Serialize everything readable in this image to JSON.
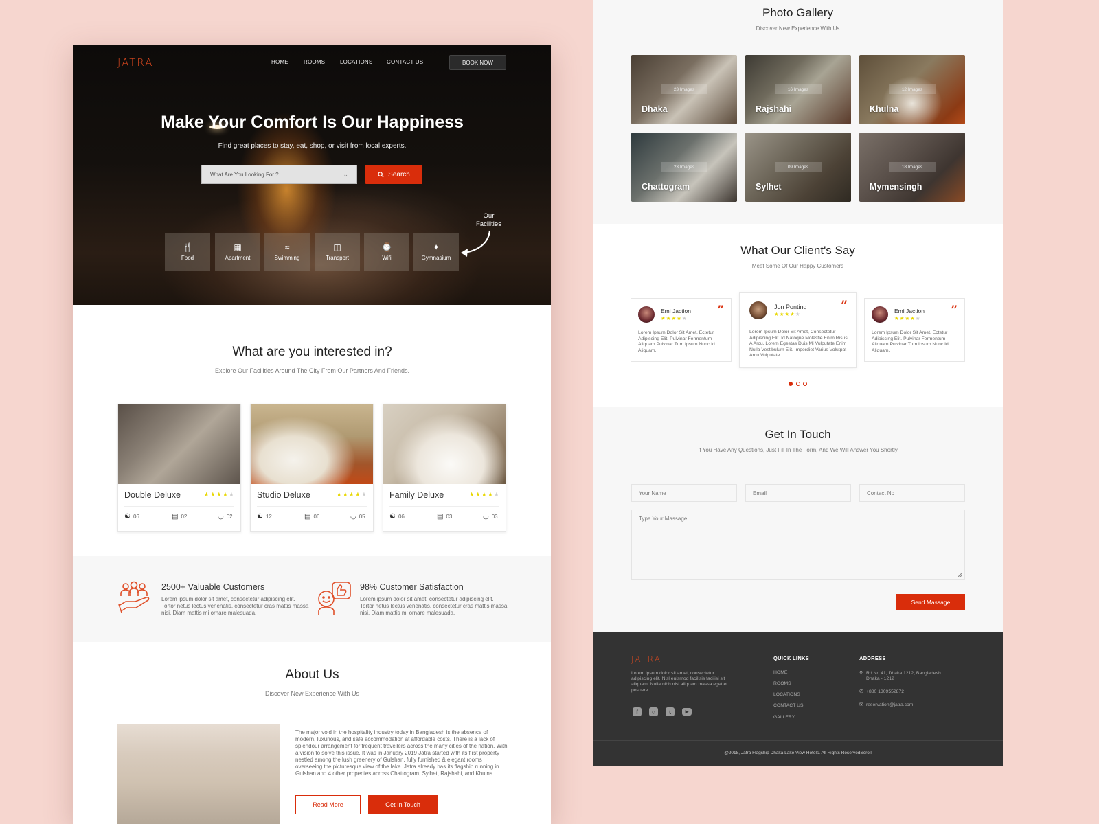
{
  "brand": {
    "logo": "JATRA",
    "accent": "#d92d0b"
  },
  "nav": {
    "links": [
      "HOME",
      "ROOMS",
      "LOCATIONS",
      "CONTACT US"
    ],
    "book_now": "BOOK NOW"
  },
  "hero": {
    "title": "Make Your Comfort Is Our Happiness",
    "subtitle": "Find great places to stay, eat, shop, or visit from local experts.",
    "search_placeholder": "What Are You Looking For ?",
    "search_button": "Search",
    "facilities_label_1": "Our",
    "facilities_label_2": "Facilities",
    "facilities": [
      {
        "label": "Food",
        "icon": "cutlery-icon"
      },
      {
        "label": "Apartment",
        "icon": "building-icon"
      },
      {
        "label": "Swimming",
        "icon": "swimmer-icon"
      },
      {
        "label": "Transport",
        "icon": "van-icon"
      },
      {
        "label": "Wifi",
        "icon": "wifi-icon"
      },
      {
        "label": "Gymnasium",
        "icon": "gymnast-icon"
      }
    ]
  },
  "interested": {
    "title": "What are you interested in?",
    "subtitle": "Explore Our Facilities Around The City From Our Partners And Friends.",
    "rooms": [
      {
        "name": "Double Deluxe",
        "rating": 4,
        "max_rating": 5,
        "guests": "06",
        "beds": "02",
        "baths": "02"
      },
      {
        "name": "Studio Deluxe",
        "rating": 4,
        "max_rating": 5,
        "guests": "12",
        "beds": "06",
        "baths": "05"
      },
      {
        "name": "Family Deluxe",
        "rating": 4,
        "max_rating": 5,
        "guests": "06",
        "beds": "03",
        "baths": "03"
      }
    ]
  },
  "stats": [
    {
      "title": "2500+ Valuable Customers",
      "text": "Lorem ipsum dolor sit amet, consectetur adipiscing elit. Tortor netus lectus venenatis, consectetur cras mattis massa nisi. Diam mattis mi ornare malesuada."
    },
    {
      "title": "98% Customer Satisfaction",
      "text": "Lorem ipsum dolor sit amet, consectetur adipiscing elit. Tortor netus lectus venenatis, consectetur cras mattis massa nisi. Diam mattis mi ornare malesuada."
    }
  ],
  "about": {
    "title": "About Us",
    "subtitle": "Discover New Experience With Us",
    "text": "The major void in the hospitality industry today in Bangladesh is the absence of modern, luxurious, and safe accommodation at affordable costs. There is a lack of splendour arrangement for frequent travellers across the many cities of the nation. With a vision to solve this issue, It was in January 2019 Jatra started with its first property nestled among the lush greenery of Gulshan, fully furnished & elegant rooms overseeing the picturesque view of the lake. Jatra already has its flagship running in Gulshan and 4 other properties across Chattogram, Sylhet, Rajshahi, and Khulna..",
    "read_more": "Read More",
    "get_in_touch": "Get In Touch"
  },
  "gallery": {
    "title": "Photo Gallery",
    "subtitle": "Discover New Experience With Us",
    "items": [
      {
        "city": "Dhaka",
        "count": "23 Images"
      },
      {
        "city": "Rajshahi",
        "count": "16 Images"
      },
      {
        "city": "Khulna",
        "count": "12 Images"
      },
      {
        "city": "Chattogram",
        "count": "23 Images"
      },
      {
        "city": "Sylhet",
        "count": "09 Images"
      },
      {
        "city": "Mymensingh",
        "count": "18 Images"
      }
    ]
  },
  "testimonials": {
    "title": "What Our Client's Say",
    "subtitle": "Meet Some Of Our Happy Customers",
    "items": [
      {
        "name": "Emi Jaction",
        "rating": 4,
        "text": "Lorem Ipsum Dolor Sit Amet, Ectetur Adipiscing Elit. Pulvinar Fermentum Aliquam.Pulvinar Tum Ipsum Nunc Id Aliquam."
      },
      {
        "name": "Jon Ponting",
        "rating": 4,
        "text": "Lorem Ipsum Dolor Sit Amet, Consectetur Adipiscing Elit. Id Natoque Molestie Enim Risus A Arcu. Lorem Egestas Duis Mi Vulputate Enim Nulla Vestibulum Elit. Imperdiet Varius Volutpat Arcu Vulputate."
      },
      {
        "name": "Emi Jaction",
        "rating": 4,
        "text": "Lorem Ipsum Dolor Sit Amet, Ectetur Adipiscing Elit. Pulvinar Fermentum Aliquam.Pulvinar Tum Ipsum Nunc Id Aliquam."
      }
    ],
    "active_slide": 1,
    "slide_count": 3
  },
  "contact": {
    "title": "Get In Touch",
    "subtitle": "If You Have Any Questions, Just Fill In The Form, And We Will Answer You Shortly",
    "name_placeholder": "Your Name",
    "email_placeholder": "Email",
    "contact_placeholder": "Contact No",
    "message_placeholder": "Type Your Massage",
    "send": "Send Massage"
  },
  "footer": {
    "about": "Lorem ipsum dolor sit amet, consectetur adipiscing elit. Nisl euismod facilisis facilisi sit aliquam. Nulla nibh nisl aliquam massa eget et posuere.",
    "quick_links_title": "QUICK LINKS",
    "quick_links": [
      "HOME",
      "ROOMS",
      "LOCATIONS",
      "CONTACT US",
      "GALLERY"
    ],
    "address_title": "ADDRESS",
    "address_1": "Rd No 41, Dhaka 1212, Bangladesh",
    "address_2": "Dhaka - 1212",
    "phone": "+880 1309552872",
    "email": "reservation@jatra.com",
    "copyright": "@2018, Jatra Flagship Dhaka Lake View Hotels. All Rights ReservedScroll"
  }
}
